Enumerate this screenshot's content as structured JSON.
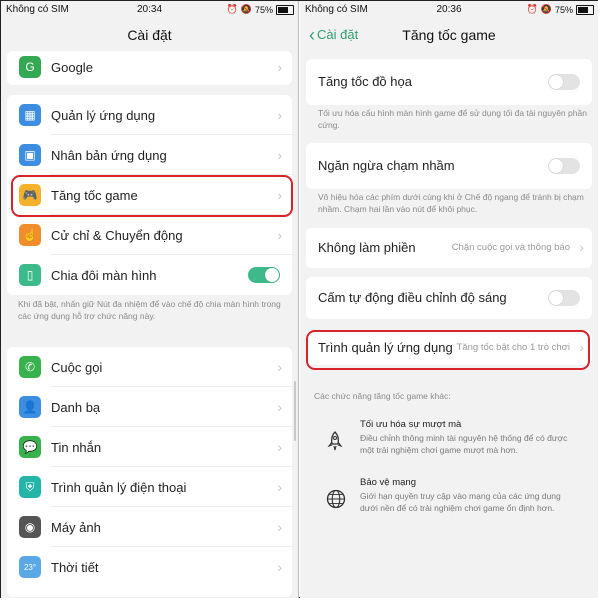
{
  "left": {
    "status": {
      "carrier": "Không có SIM",
      "time": "20:34",
      "battery": "75%"
    },
    "title": "Cài đặt",
    "top_item": {
      "label": "Google",
      "icon": "google-icon",
      "color": "#34a853"
    },
    "group1": [
      {
        "label": "Quản lý ứng dụng",
        "icon": "apps-icon",
        "color": "#3d8de0"
      },
      {
        "label": "Nhân bản ứng dụng",
        "icon": "clone-icon",
        "color": "#3d8de0"
      },
      {
        "label": "Tăng tốc game",
        "icon": "gamepad-icon",
        "color": "#f4b12c"
      },
      {
        "label": "Cử chỉ & Chuyển động",
        "icon": "gesture-icon",
        "color": "#f08d2c"
      },
      {
        "label": "Chia đôi màn hình",
        "icon": "split-screen-icon",
        "color": "#3cba8c"
      }
    ],
    "split_toggle_on": true,
    "note": "Khi đã bật, nhấn giữ Nút đa nhiệm để vào chế độ chia màn hình trong các ứng dụng hỗ trợ chức năng này.",
    "group2": [
      {
        "label": "Cuộc gọi",
        "icon": "phone-icon",
        "color": "#37b24d"
      },
      {
        "label": "Danh bạ",
        "icon": "contacts-icon",
        "color": "#3d8de0"
      },
      {
        "label": "Tin nhắn",
        "icon": "message-icon",
        "color": "#37b24d"
      },
      {
        "label": "Trình quản lý điện thoại",
        "icon": "shield-icon",
        "color": "#22b5a8"
      },
      {
        "label": "Máy ảnh",
        "icon": "camera-icon",
        "color": "#555555"
      },
      {
        "label": "Thời tiết",
        "icon": "weather-icon",
        "color": "#5aa9e6",
        "icon_text": "23°"
      }
    ]
  },
  "right": {
    "status": {
      "carrier": "Không có SIM",
      "time": "20:36",
      "battery": "75%"
    },
    "back_label": "Cài đặt",
    "title": "Tăng tốc game",
    "rows": [
      {
        "label": "Tăng tốc đồ họa",
        "toggle": false,
        "note": "Tối ưu hóa cấu hình màn hình game để sử dụng tối đa tài nguyên phần cứng."
      },
      {
        "label": "Ngăn ngừa chạm nhầm",
        "toggle": false,
        "note": "Vô hiệu hóa các phím dưới cùng khi ở Chế độ ngang để tránh bị chạm nhầm. Chạm hai lần vào nút để khôi phục."
      },
      {
        "label": "Không làm phiền",
        "value": "Chặn cuộc gọi và thông báo"
      },
      {
        "label": "Cấm tự động điều chỉnh độ sáng",
        "toggle": false
      },
      {
        "label": "Trình quản lý ứng dụng",
        "value": "Tăng tốc bật cho 1 trò chơi"
      }
    ],
    "other_header": "Các chức năng tăng tốc game khác:",
    "features": [
      {
        "title": "Tối ưu hóa sự mượt mà",
        "desc": "Điều chỉnh thông minh tài nguyên hệ thống để có được một trải nghiệm chơi game mượt mà hơn.",
        "icon": "rocket-icon"
      },
      {
        "title": "Bảo vệ mạng",
        "desc": "Giới hạn quyền truy cập vào mạng của các ứng dụng dưới nền để có trải nghiệm chơi game ổn định hơn.",
        "icon": "globe-icon"
      }
    ]
  }
}
